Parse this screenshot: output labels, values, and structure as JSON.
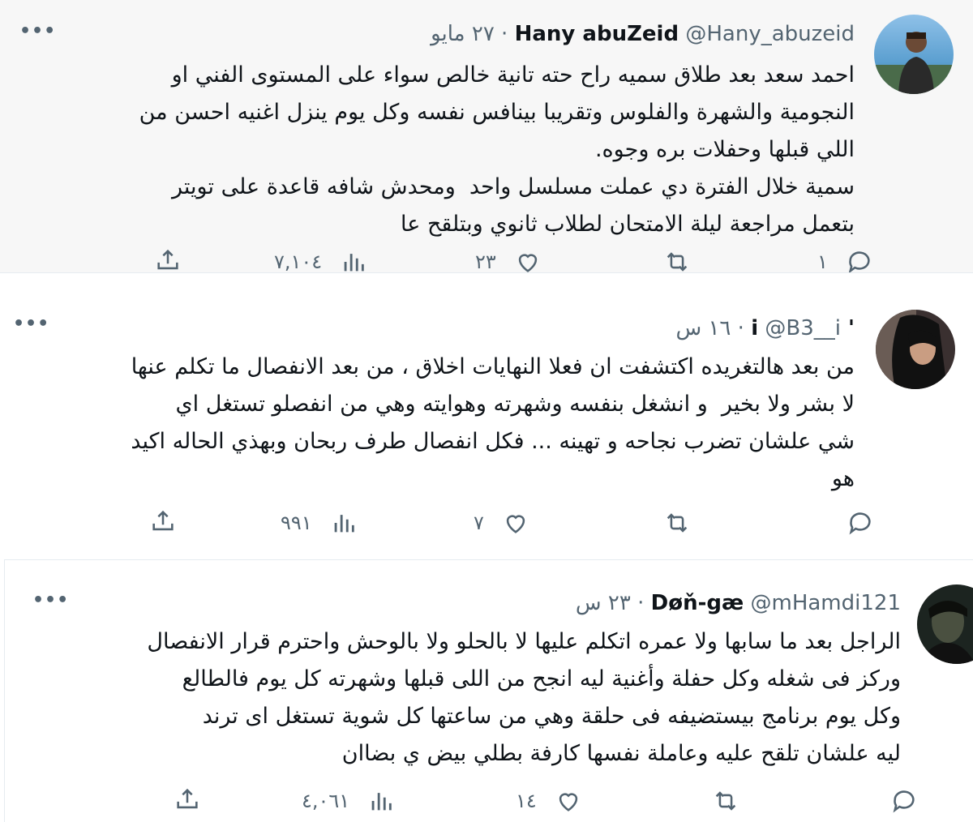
{
  "tweets": [
    {
      "name": "Hany abuZeid",
      "handle": "@Hany_abuzeid",
      "time": "٢٧ مايو",
      "text": "احمد سعد بعد طلاق سميه راح حته تانية خالص سواء على المستوى الفني او\nالنجومية والشهرة والفلوس وتقريبا بينافس نفسه وكل يوم ينزل اغنيه احسن من\nاللي قبلها وحفلات بره وجوه.\nسمية خلال الفترة دي عملت مسلسل واحد  ومحدش شافه قاعدة على تويتر\nبتعمل مراجعة ليلة الامتحان لطلاب ثانوي وبتلقح عا",
      "replies": "١",
      "retweets": "",
      "likes": "٢٣",
      "views": "٧,١٠٤",
      "more": "•••"
    },
    {
      "name": "' i",
      "handle": "@B3__i",
      "time": "١٦ س",
      "text": "من بعد هالتغريده اكتشفت ان فعلا النهايات اخلاق ، من بعد الانفصال ما تكلم عنها\nلا بشر ولا بخير  و انشغل بنفسه وشهرته وهوايته وهي من انفصلو تستغل اي\nشي علشان تضرب نجاحه و تهينه ... فكل انفصال طرف ربحان وبهذي الحاله اكيد\nهو",
      "replies": "",
      "retweets": "",
      "likes": "٧",
      "views": "٩٩١",
      "more": "•••"
    },
    {
      "name": "Døň-gæ",
      "handle": "@mHamdi121",
      "time": "٢٣ س",
      "text": "الراجل بعد ما سابها ولا عمره اتكلم عليها لا بالحلو ولا بالوحش واحترم قرار الانفصال\nوركز فى شغله وكل حفلة وأغنية ليه انجح من اللى قبلها وشهرته كل يوم فالطالع\nوكل يوم برنامج بيستضيفه فى حلقة وهي من ساعتها كل شوية تستغل اى ترند\nليه علشان تلقح عليه وعاملة نفسها كارفة بطلي بيض ي بضاان",
      "replies": "",
      "retweets": "",
      "likes": "١٤",
      "views": "٤,٠٦١",
      "more": "•••"
    }
  ],
  "header_separator": " · ",
  "icons": {
    "reply": "reply-icon",
    "retweet": "retweet-icon",
    "like": "heart-icon",
    "views": "views-icon",
    "share": "share-icon",
    "more": "more-icon"
  },
  "colors": {
    "text": "#0f1419",
    "secondary": "#536471",
    "highlight_bg": "#f7f7f7"
  }
}
